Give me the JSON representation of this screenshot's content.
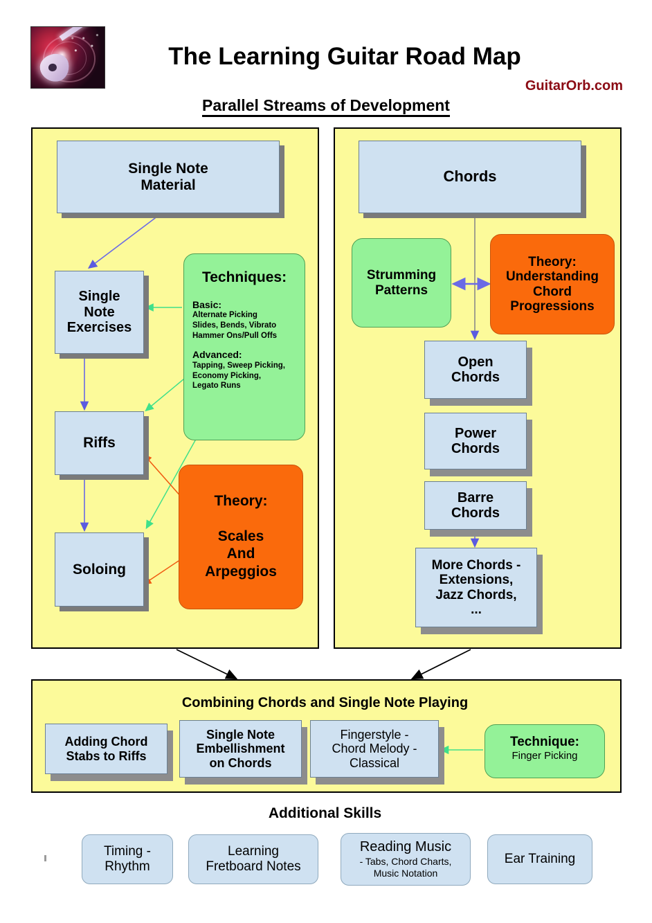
{
  "header": {
    "title": "The Learning Guitar Road Map",
    "brand": "GuitarOrb.com",
    "subtitle": "Parallel Streams of Development",
    "logo_icon": "guitar-logo-icon"
  },
  "colors": {
    "panel_background": "#FCFA9A",
    "node_blue": "#CFE1F1",
    "node_green": "#94F298",
    "node_orange": "#FA6A0C",
    "brand_red": "#8B0B14",
    "arrow_blue": "#5B5BE0",
    "arrow_green": "#3FE08A",
    "arrow_orange": "#F05A10",
    "arrow_black": "#000000",
    "shadow_gray": "#7A7A7A"
  },
  "left_stream": {
    "root": "Single Note\nMaterial",
    "root_line1": "Single Note",
    "root_line2": "Material",
    "exercises_line1": "Single",
    "exercises_line2": "Note",
    "exercises_line3": "Exercises",
    "riffs": "Riffs",
    "soloing": "Soloing",
    "techniques": {
      "title": "Techniques:",
      "basic_heading": "Basic:",
      "basic_items": "Alternate Picking\nSlides, Bends, Vibrato\nHammer Ons/Pull Offs",
      "basic_line1": "Alternate Picking",
      "basic_line2": "Slides, Bends, Vibrato",
      "basic_line3": "Hammer Ons/Pull Offs",
      "advanced_heading": "Advanced:",
      "advanced_line1": "Tapping, Sweep Picking,",
      "advanced_line2": "Economy Picking,",
      "advanced_line3": "Legato Runs"
    },
    "theory": {
      "title": "Theory:",
      "line1": "Scales",
      "line2": "And",
      "line3": "Arpeggios"
    }
  },
  "right_stream": {
    "root": "Chords",
    "strumming_line1": "Strumming",
    "strumming_line2": "Patterns",
    "theory": {
      "title": "Theory:",
      "line1": "Understanding",
      "line2": "Chord",
      "line3": "Progressions"
    },
    "open_line1": "Open",
    "open_line2": "Chords",
    "power_line1": "Power",
    "power_line2": "Chords",
    "barre_line1": "Barre",
    "barre_line2": "Chords",
    "more_line1": "More Chords -",
    "more_line2": "Extensions,",
    "more_line3": "Jazz Chords,",
    "more_line4": "..."
  },
  "combining": {
    "title": "Combining Chords and Single Note Playing",
    "box1_line1": "Adding Chord",
    "box1_line2": "Stabs to Riffs",
    "box2_line1": "Single Note",
    "box2_line2": "Embellishment",
    "box2_line3": "on Chords",
    "box3_line1": "Fingerstyle -",
    "box3_line2": "Chord Melody -",
    "box3_line3": "Classical",
    "technique_title": "Technique:",
    "technique_sub": "Finger Picking"
  },
  "additional_skills": {
    "title": "Additional Skills",
    "items": [
      {
        "line1": "Timing -",
        "line2": "Rhythm"
      },
      {
        "line1": "Learning",
        "line2": "Fretboard Notes"
      },
      {
        "line1": "Reading Music",
        "line2": "- Tabs, Chord Charts,",
        "line3": "Music Notation"
      },
      {
        "line1": "Ear Training",
        "line2": ""
      }
    ]
  }
}
